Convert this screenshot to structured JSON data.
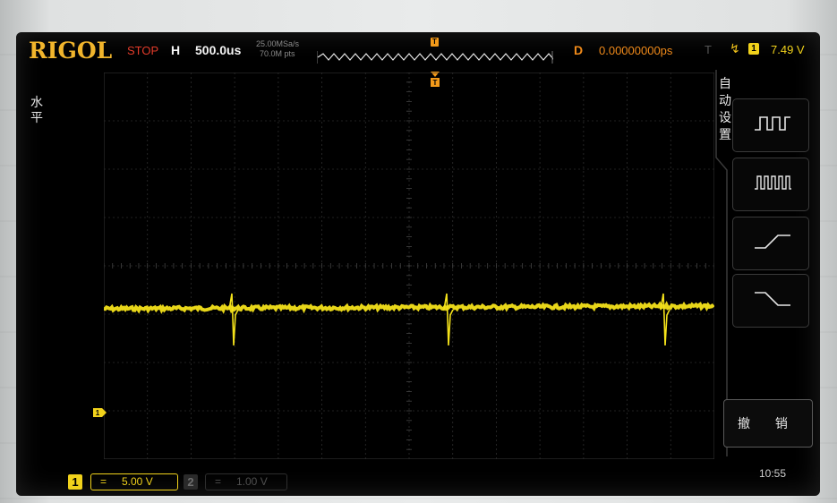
{
  "header": {
    "brand": "RIGOL",
    "run_state": "STOP",
    "horizontal_label": "H",
    "timebase": "500.0us",
    "sample_rate": "25.00MSa/s",
    "memory_depth": "70.0M pts",
    "trigger_marker": "T",
    "delay_label": "D",
    "delay_value": "0.00000000ps",
    "trigger_label": "T",
    "trigger_source": "1",
    "trigger_level": "7.49 V"
  },
  "left_label": "水平",
  "menu": {
    "title": "自动设置",
    "items": [
      "multi-period-icon",
      "multi-cycle-icon",
      "rising-edge-icon",
      "falling-edge-icon"
    ],
    "undo_label": "撤 销"
  },
  "footer": {
    "ch1": {
      "number": "1",
      "coupling": "=",
      "scale": "5.00 V",
      "active": true
    },
    "ch2": {
      "number": "2",
      "coupling": "=",
      "scale": "1.00 V",
      "active": false
    },
    "clock": "10:55"
  },
  "colors": {
    "trace": "#f4e21a",
    "brand": "#f1b52c",
    "stop": "#e23b2a",
    "delay": "#f08a1a",
    "grid": "#2d2d2d"
  }
}
